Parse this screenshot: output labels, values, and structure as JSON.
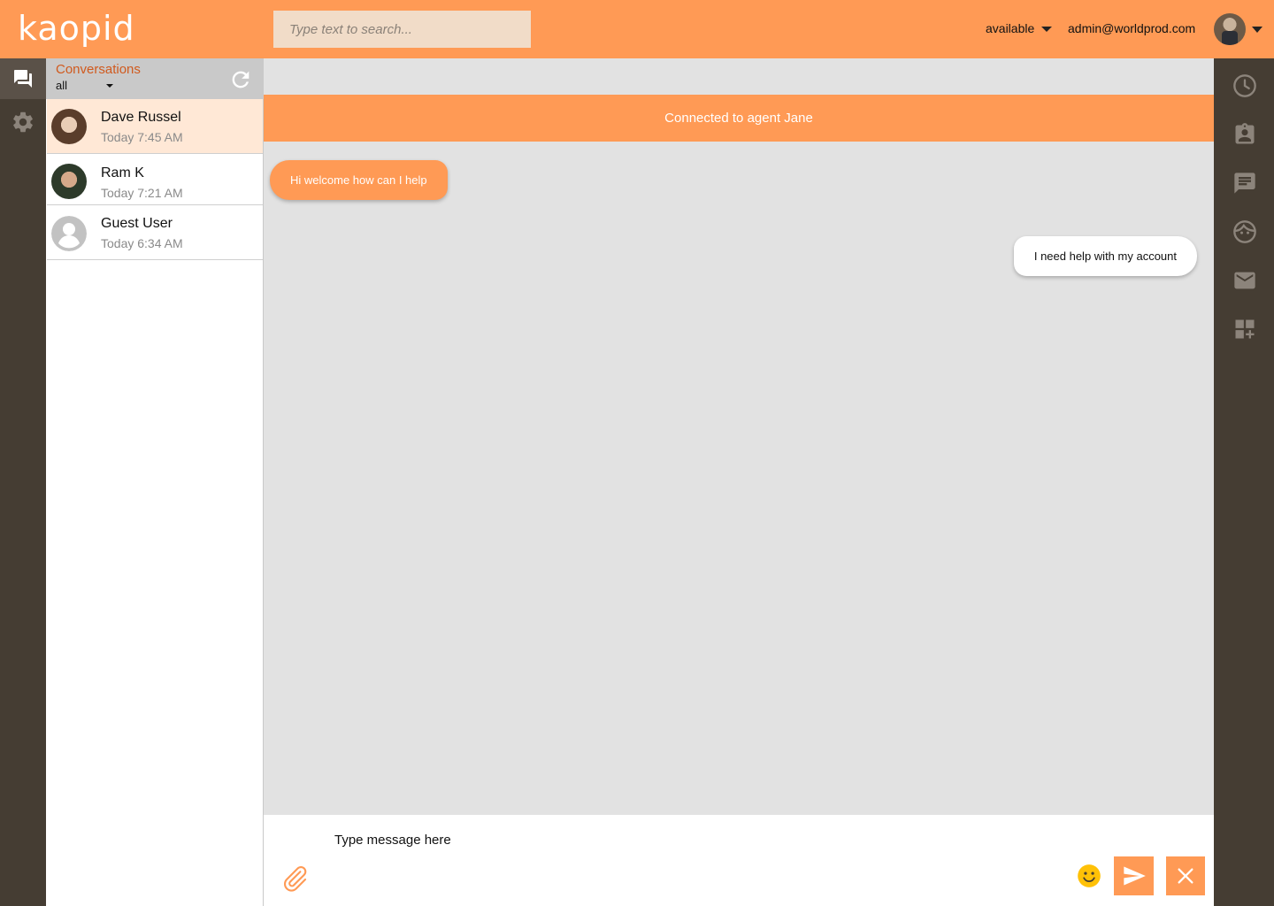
{
  "app": {
    "logo_text": "kaopid",
    "brand_color": "#ff9a55",
    "dark_color": "#453d33"
  },
  "header": {
    "search_placeholder": "Type text to search...",
    "status": "available",
    "user_email": "admin@worldprod.com"
  },
  "sidebar_left": {
    "items": [
      {
        "icon": "forum-icon",
        "active": true
      },
      {
        "icon": "gear-icon",
        "active": false
      }
    ]
  },
  "conversations": {
    "title": "Conversations",
    "filter": "all",
    "items": [
      {
        "name": "Dave Russel",
        "time": "Today 7:45 AM",
        "selected": true,
        "avatar": "avatar-photo"
      },
      {
        "name": "Ram K",
        "time": "Today 7:21 AM",
        "selected": false,
        "avatar": "avatar-photo"
      },
      {
        "name": "Guest User",
        "time": "Today 6:34 AM",
        "selected": false,
        "avatar": "default-person-icon"
      }
    ]
  },
  "chat": {
    "banner": "Connected to agent Jane",
    "messages": [
      {
        "from": "agent",
        "text": "Hi welcome how can I help"
      },
      {
        "from": "user",
        "text": "I need help with my account"
      }
    ]
  },
  "composer": {
    "placeholder": "Type message here"
  },
  "sidebar_right": {
    "items": [
      "history-icon",
      "contact-card-icon",
      "message-icon",
      "face-icon",
      "mail-icon",
      "add-widget-icon"
    ]
  }
}
